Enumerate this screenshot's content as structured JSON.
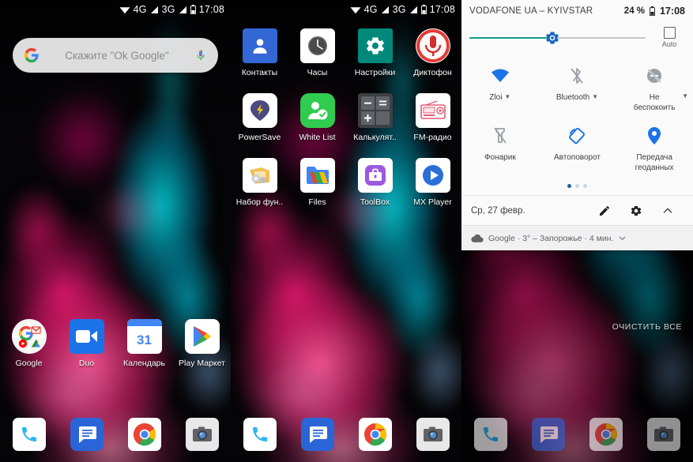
{
  "status_bar": {
    "time": "17:08",
    "net1": "4G",
    "net2": "3G",
    "icons": [
      "wifi-icon",
      "signal-4g-icon",
      "signal-3g-icon",
      "battery-icon"
    ]
  },
  "home_left": {
    "search": {
      "placeholder": "Скажите \"Ok Google\"",
      "google_icon": "google-g-icon",
      "mic_icon": "microphone-icon"
    },
    "row": [
      {
        "label": "Google",
        "icon": "google-folder-icon"
      },
      {
        "label": "Duo",
        "icon": "duo-icon"
      },
      {
        "label": "Календарь",
        "icon": "calendar-icon",
        "day": "31"
      },
      {
        "label": "Play Маркет",
        "icon": "play-store-icon"
      }
    ]
  },
  "home_mid": {
    "apps": [
      {
        "label": "Контакты",
        "icon": "contacts-icon"
      },
      {
        "label": "Часы",
        "icon": "clock-icon"
      },
      {
        "label": "Настройки",
        "icon": "settings-gear-icon"
      },
      {
        "label": "Диктофон",
        "icon": "voice-recorder-icon"
      },
      {
        "label": "PowerSave",
        "icon": "powersave-icon"
      },
      {
        "label": "White List",
        "icon": "white-list-icon"
      },
      {
        "label": "Калькулят..",
        "icon": "calculator-icon"
      },
      {
        "label": "FM-радио",
        "icon": "fm-radio-icon"
      },
      {
        "label": "Набор фун..",
        "icon": "toolkit-icon"
      },
      {
        "label": "Files",
        "icon": "files-icon"
      },
      {
        "label": "ToolBox",
        "icon": "toolbox-icon"
      },
      {
        "label": "MX Player",
        "icon": "mx-player-icon"
      }
    ]
  },
  "dock": [
    {
      "label": "phone",
      "icon": "phone-icon"
    },
    {
      "label": "messages",
      "icon": "messages-icon"
    },
    {
      "label": "chrome",
      "icon": "chrome-icon"
    },
    {
      "label": "camera",
      "icon": "camera-icon"
    }
  ],
  "quick_settings": {
    "carrier": "VODAFONE UA – KYIVSTAR",
    "battery": "24 %",
    "time": "17:08",
    "brightness": {
      "percent": 47,
      "auto_label": "Auto",
      "thumb_icon": "brightness-gear-icon"
    },
    "tiles": [
      {
        "label": "Zloi",
        "icon": "wifi-icon",
        "state": "on",
        "caret": true
      },
      {
        "label": "Bluetooth",
        "icon": "bluetooth-off-icon",
        "state": "off",
        "caret": true
      },
      {
        "label": "Не\nбеспокоить",
        "icon": "do-not-disturb-icon",
        "state": "off",
        "caret": true
      },
      {
        "label": "Фонарик",
        "icon": "flashlight-off-icon",
        "state": "off",
        "caret": false
      },
      {
        "label": "Автоповорот",
        "icon": "auto-rotate-icon",
        "state": "on",
        "caret": false
      },
      {
        "label": "Передача\nгеоданных",
        "icon": "location-pin-icon",
        "state": "on",
        "caret": false
      }
    ],
    "page_dots": {
      "count": 3,
      "active": 0
    },
    "footer": {
      "date": "Ср, 27 февр.",
      "edit_icon": "pencil-icon",
      "settings_icon": "gear-icon",
      "collapse_icon": "chevron-up-icon"
    },
    "notification": {
      "app": "Google",
      "text": "Google · 3° – Запорожье · 4 мин.",
      "icon": "cloud-icon",
      "expand_icon": "chevron-down-icon"
    },
    "clear_all": "ОЧИСТИТЬ ВСЕ"
  },
  "colors": {
    "accent_blue": "#1a73e8",
    "slider_teal": "#0f9b8e",
    "panel_bg": "#fafafa",
    "dot_active": "#1f5fa8"
  }
}
